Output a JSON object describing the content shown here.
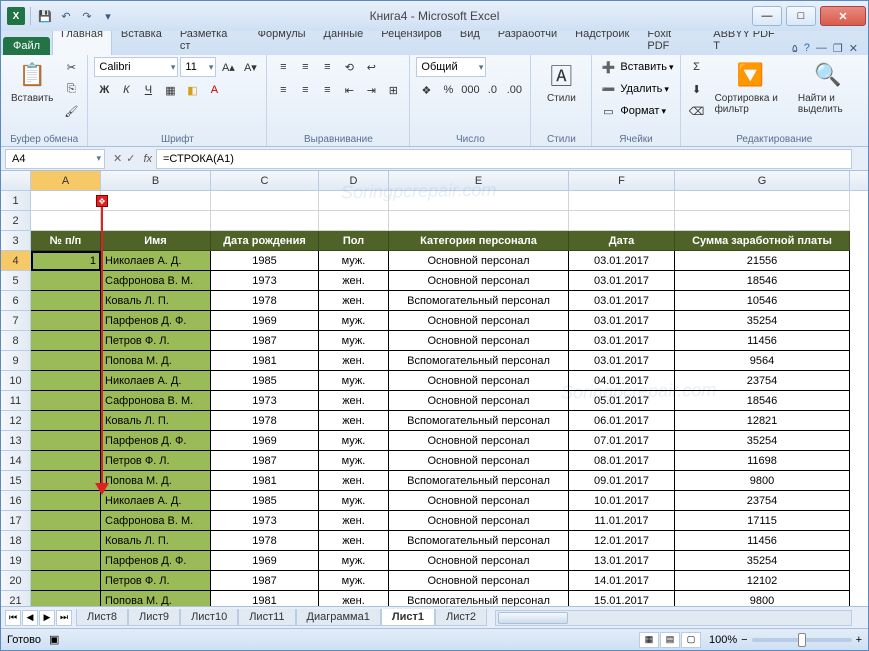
{
  "title": "Книга4 - Microsoft Excel",
  "file_tab": "Файл",
  "tabs": [
    "Главная",
    "Вставка",
    "Разметка ст",
    "Формулы",
    "Данные",
    "Рецензиров",
    "Вид",
    "Разработчи",
    "Надстройк",
    "Foxit PDF",
    "ABBYY PDF T"
  ],
  "active_tab": 0,
  "ribbon": {
    "clipboard": {
      "label": "Буфер обмена",
      "paste": "Вставить"
    },
    "font": {
      "label": "Шрифт",
      "name": "Calibri",
      "size": "11"
    },
    "align": {
      "label": "Выравнивание"
    },
    "number": {
      "label": "Число",
      "format": "Общий"
    },
    "styles": {
      "label": "Стили",
      "btn": "Стили"
    },
    "cells": {
      "label": "Ячейки",
      "insert": "Вставить",
      "delete": "Удалить",
      "format": "Формат"
    },
    "editing": {
      "label": "Редактирование",
      "sort": "Сортировка и фильтр",
      "find": "Найти и выделить"
    }
  },
  "namebox": "A4",
  "formula": "=СТРОКА(A1)",
  "columns": [
    "A",
    "B",
    "C",
    "D",
    "E",
    "F",
    "G"
  ],
  "col_widths": [
    "wA",
    "wB",
    "wC",
    "wD",
    "wE",
    "wF",
    "wG"
  ],
  "header_row_num": 3,
  "headers": [
    "№ п/п",
    "Имя",
    "Дата рождения",
    "Пол",
    "Категория персонала",
    "Дата",
    "Сумма заработной платы"
  ],
  "data_start_row": 4,
  "data": [
    {
      "num": "1",
      "name": "Николаев А. Д.",
      "birth": "1985",
      "sex": "муж.",
      "cat": "Основной персонал",
      "date": "03.01.2017",
      "sum": "21556"
    },
    {
      "num": "",
      "name": "Сафронова В. М.",
      "birth": "1973",
      "sex": "жен.",
      "cat": "Основной персонал",
      "date": "03.01.2017",
      "sum": "18546"
    },
    {
      "num": "",
      "name": "Коваль Л. П.",
      "birth": "1978",
      "sex": "жен.",
      "cat": "Вспомогательный персонал",
      "date": "03.01.2017",
      "sum": "10546"
    },
    {
      "num": "",
      "name": "Парфенов Д. Ф.",
      "birth": "1969",
      "sex": "муж.",
      "cat": "Основной персонал",
      "date": "03.01.2017",
      "sum": "35254"
    },
    {
      "num": "",
      "name": "Петров Ф. Л.",
      "birth": "1987",
      "sex": "муж.",
      "cat": "Основной персонал",
      "date": "03.01.2017",
      "sum": "11456"
    },
    {
      "num": "",
      "name": "Попова М. Д.",
      "birth": "1981",
      "sex": "жен.",
      "cat": "Вспомогательный персонал",
      "date": "03.01.2017",
      "sum": "9564"
    },
    {
      "num": "",
      "name": "Николаев А. Д.",
      "birth": "1985",
      "sex": "муж.",
      "cat": "Основной персонал",
      "date": "04.01.2017",
      "sum": "23754"
    },
    {
      "num": "",
      "name": "Сафронова В. М.",
      "birth": "1973",
      "sex": "жен.",
      "cat": "Основной персонал",
      "date": "05.01.2017",
      "sum": "18546"
    },
    {
      "num": "",
      "name": "Коваль Л. П.",
      "birth": "1978",
      "sex": "жен.",
      "cat": "Вспомогательный персонал",
      "date": "06.01.2017",
      "sum": "12821"
    },
    {
      "num": "",
      "name": "Парфенов Д. Ф.",
      "birth": "1969",
      "sex": "муж.",
      "cat": "Основной персонал",
      "date": "07.01.2017",
      "sum": "35254"
    },
    {
      "num": "",
      "name": "Петров Ф. Л.",
      "birth": "1987",
      "sex": "муж.",
      "cat": "Основной персонал",
      "date": "08.01.2017",
      "sum": "11698"
    },
    {
      "num": "",
      "name": "Попова М. Д.",
      "birth": "1981",
      "sex": "жен.",
      "cat": "Вспомогательный персонал",
      "date": "09.01.2017",
      "sum": "9800"
    },
    {
      "num": "",
      "name": "Николаев А. Д.",
      "birth": "1985",
      "sex": "муж.",
      "cat": "Основной персонал",
      "date": "10.01.2017",
      "sum": "23754"
    },
    {
      "num": "",
      "name": "Сафронова В. М.",
      "birth": "1973",
      "sex": "жен.",
      "cat": "Основной персонал",
      "date": "11.01.2017",
      "sum": "17115"
    },
    {
      "num": "",
      "name": "Коваль Л. П.",
      "birth": "1978",
      "sex": "жен.",
      "cat": "Вспомогательный персонал",
      "date": "12.01.2017",
      "sum": "11456"
    },
    {
      "num": "",
      "name": "Парфенов Д. Ф.",
      "birth": "1969",
      "sex": "муж.",
      "cat": "Основной персонал",
      "date": "13.01.2017",
      "sum": "35254"
    },
    {
      "num": "",
      "name": "Петров Ф. Л.",
      "birth": "1987",
      "sex": "муж.",
      "cat": "Основной персонал",
      "date": "14.01.2017",
      "sum": "12102"
    },
    {
      "num": "",
      "name": "Попова М. Д.",
      "birth": "1981",
      "sex": "жен.",
      "cat": "Вспомогательный персонал",
      "date": "15.01.2017",
      "sum": "9800"
    }
  ],
  "sheet_tabs": [
    "Лист8",
    "Лист9",
    "Лист10",
    "Лист11",
    "Диаграмма1",
    "Лист1",
    "Лист2"
  ],
  "active_sheet": 5,
  "status": "Готово",
  "zoom": "100%",
  "watermark": "Soringpcrepair.com"
}
